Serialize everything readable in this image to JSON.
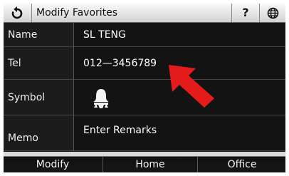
{
  "titlebar": {
    "title": "Modify Favorites",
    "back_icon": "refresh-back-icon",
    "help_label": "?",
    "language_icon": "globe-icon"
  },
  "fields": {
    "name_label": "Name",
    "name_value": "SL TENG",
    "tel_label": "Tel",
    "tel_value": "012—3456789",
    "symbol_label": "Symbol",
    "symbol_icon": "person-bell-icon",
    "memo_label": "Memo",
    "memo_placeholder": "Enter Remarks"
  },
  "buttons": {
    "modify": "Modify",
    "home": "Home",
    "office": "Office"
  },
  "colors": {
    "pointer_arrow": "#e31b1b",
    "background": "#111111"
  }
}
